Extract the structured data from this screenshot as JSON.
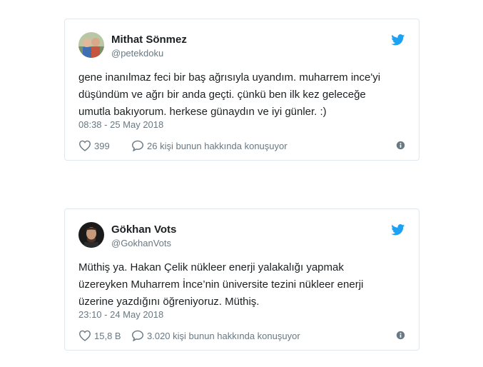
{
  "tweets": [
    {
      "name": "Mithat Sönmez",
      "handle": "@petekdoku",
      "text": "gene inanılmaz feci bir baş ağrısıyla uyandım. muharrem ince'yi\ndüşündüm ve ağrı bir anda geçti. çünkü ben ilk kez geleceğe\numutla bakıyorum. herkese günaydın ve iyi günler. :)",
      "time": "08:38 - 25 May 2018",
      "likes": "399",
      "replies": "26 kişi bunun hakkında konuşuyor"
    },
    {
      "name": "Gökhan Vots",
      "handle": "@GokhanVots",
      "text": "Müthiş ya. Hakan Çelik nükleer enerji yalakalığı yapmak\nüzereyken Muharrem İnce’nin üniversite tezini nükleer enerji\nüzerine yazdığını öğreniyoruz. Müthiş.",
      "time": "23:10 - 24 May 2018",
      "likes": "15,8 B",
      "replies": "3.020 kişi bunun hakkında konuşuyor"
    }
  ],
  "colors": {
    "twitter_blue": "#1da1f2",
    "meta_gray": "#697882",
    "border": "#e1e8ed"
  },
  "icons": [
    "twitter-bird-icon",
    "heart-icon",
    "reply-bubble-icon",
    "info-icon"
  ]
}
